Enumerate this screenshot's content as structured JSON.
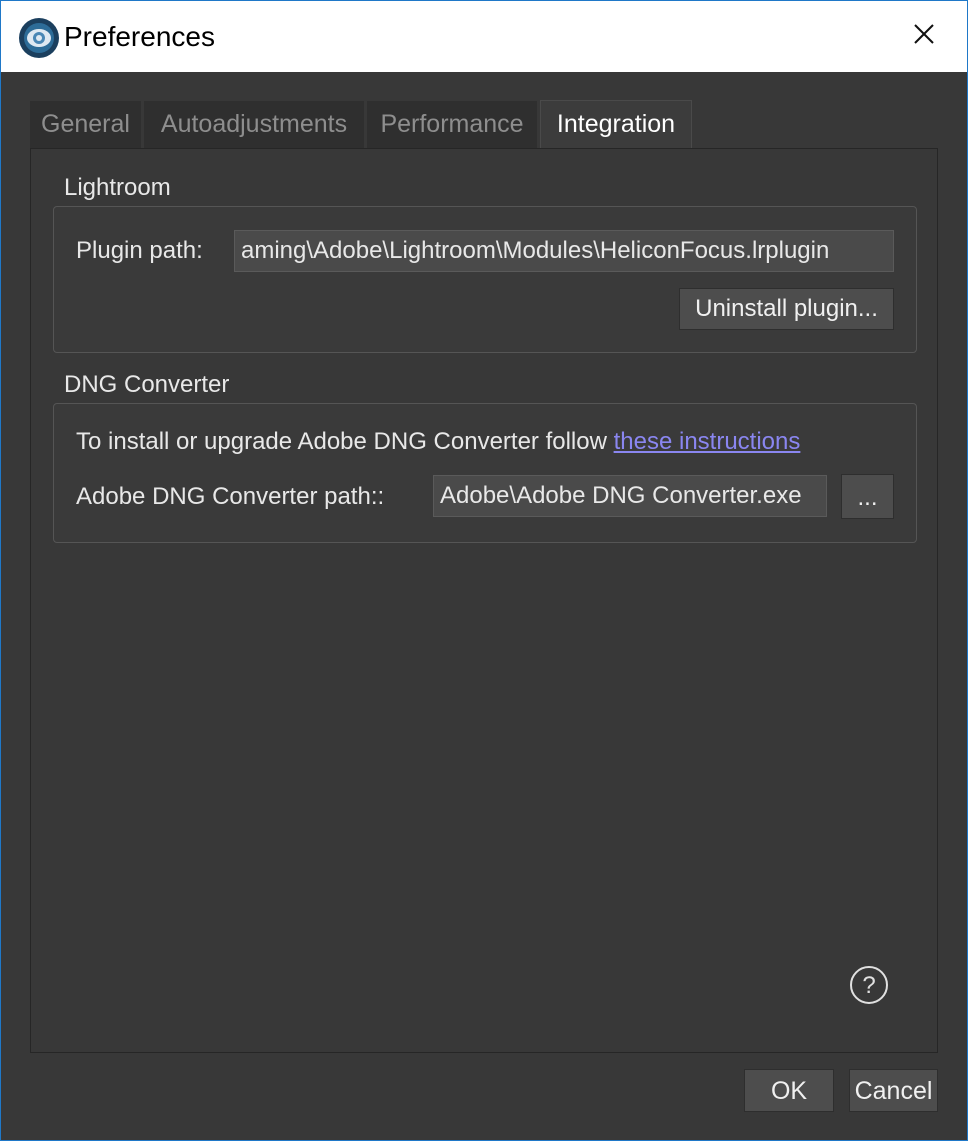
{
  "window": {
    "title": "Preferences"
  },
  "tabs": [
    {
      "label": "General",
      "active": false
    },
    {
      "label": "Autoadjustments",
      "active": false
    },
    {
      "label": "Performance",
      "active": false
    },
    {
      "label": "Integration",
      "active": true
    }
  ],
  "lightroom": {
    "section_title": "Lightroom",
    "plugin_path_label": "Plugin path:",
    "plugin_path_value": "aming\\Adobe\\Lightroom\\Modules\\HeliconFocus.lrplugin",
    "uninstall_label": "Uninstall plugin..."
  },
  "dng": {
    "section_title": "DNG Converter",
    "instruction_text": "To install or upgrade Adobe DNG Converter follow ",
    "instruction_link": "these instructions",
    "path_label": "Adobe DNG Converter path::",
    "path_value": "Adobe\\Adobe DNG Converter.exe",
    "browse_label": "..."
  },
  "footer": {
    "ok_label": "OK",
    "cancel_label": "Cancel"
  },
  "icons": {
    "app": "helicon-focus-icon",
    "close": "close-icon",
    "help": "help-icon"
  },
  "colors": {
    "background": "#383838",
    "link": "#8a86f0",
    "window_border": "#1f78c8"
  }
}
